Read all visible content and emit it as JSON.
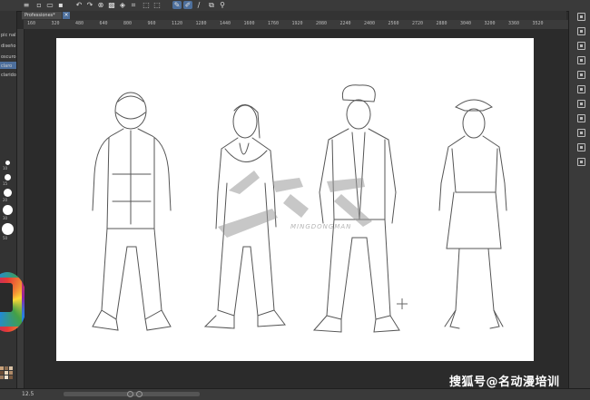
{
  "document_tab": {
    "label": "Professiones*",
    "close": "×"
  },
  "ruler_ticks": [
    "160",
    "320",
    "480",
    "640",
    "800",
    "960",
    "1120",
    "1280",
    "1440",
    "1600",
    "1760",
    "1920",
    "2080",
    "2240",
    "2400",
    "2560",
    "2720",
    "2880",
    "3040",
    "3200",
    "3360",
    "3520"
  ],
  "left_panel": {
    "items": [
      "pic nal",
      "diseño",
      "oscuro",
      "claro",
      "clarido"
    ],
    "brush_sizes": [
      "10",
      "15",
      "20",
      "30",
      "50"
    ]
  },
  "status": {
    "zoom": "12.5"
  },
  "watermark": {
    "footer": "搜狐号@名动漫培训",
    "sub": "MINGDONGMAN"
  },
  "colors": {
    "accent": "#4d6f9c",
    "paper": "#ffffff",
    "bg": "#2b2b2b"
  }
}
